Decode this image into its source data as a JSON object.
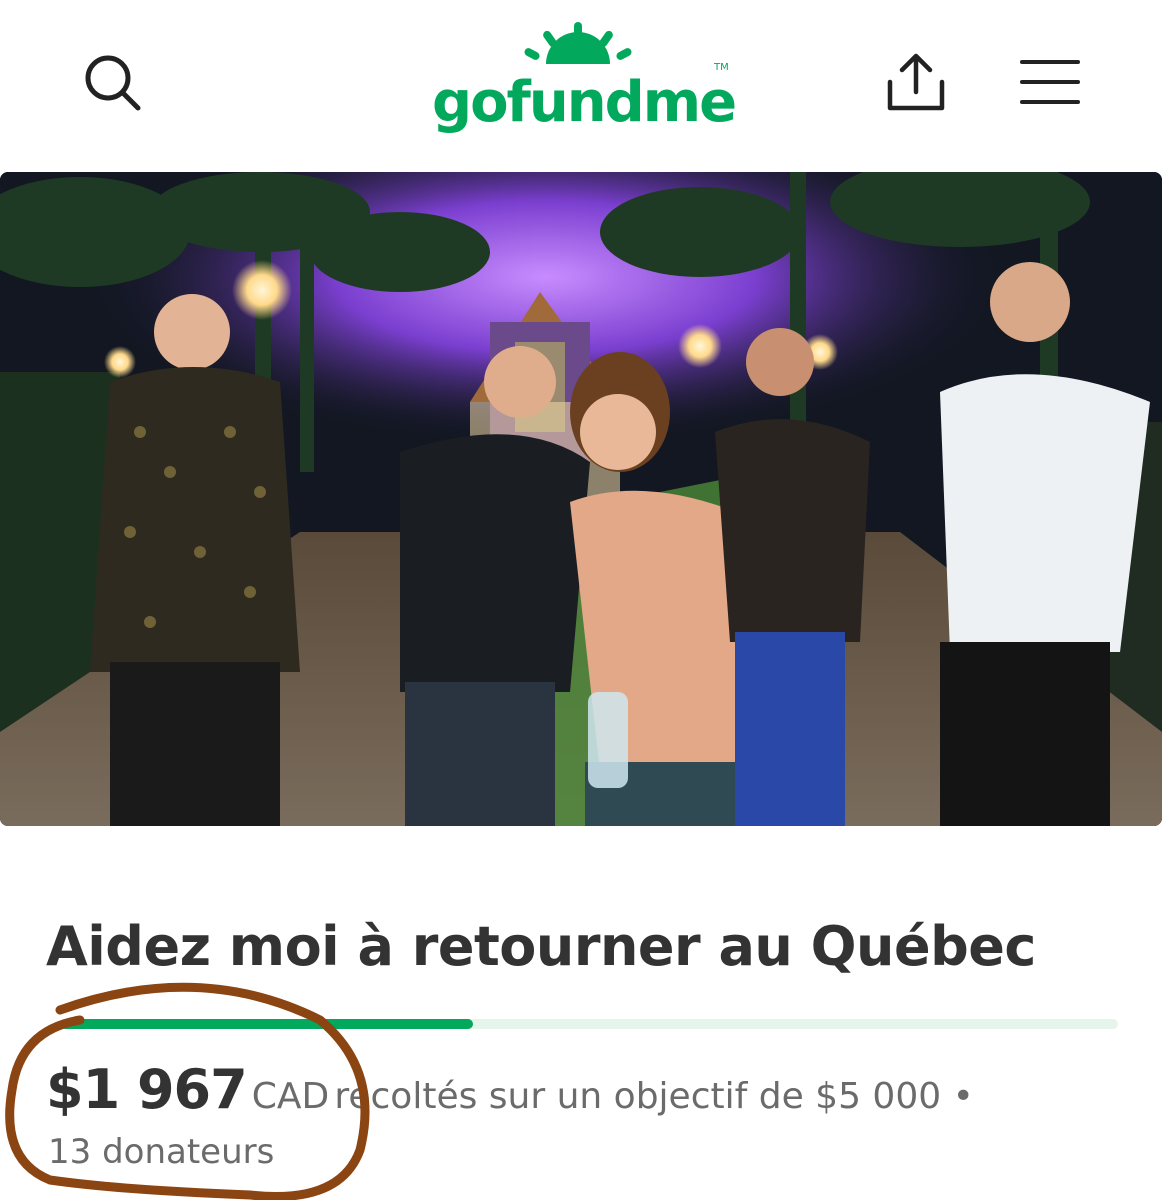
{
  "header": {
    "logo_text": "gofundme",
    "logo_tm": "TM",
    "icons": {
      "search": "search-icon",
      "share": "share-icon",
      "menu": "menu-icon"
    }
  },
  "hero": {
    "alt": "group-photo"
  },
  "campaign": {
    "title": "Aidez moi à retourner au Québec",
    "progress_fraction": 0.39,
    "amount": "$1 967",
    "currency": "CAD",
    "goal_text": "récoltés sur un objectif de $5 000 •",
    "donors": "13 donateurs"
  },
  "colors": {
    "brand_green": "#02a95c",
    "progress_track": "#e6f5ec",
    "annotation_brown": "#8b4513"
  }
}
